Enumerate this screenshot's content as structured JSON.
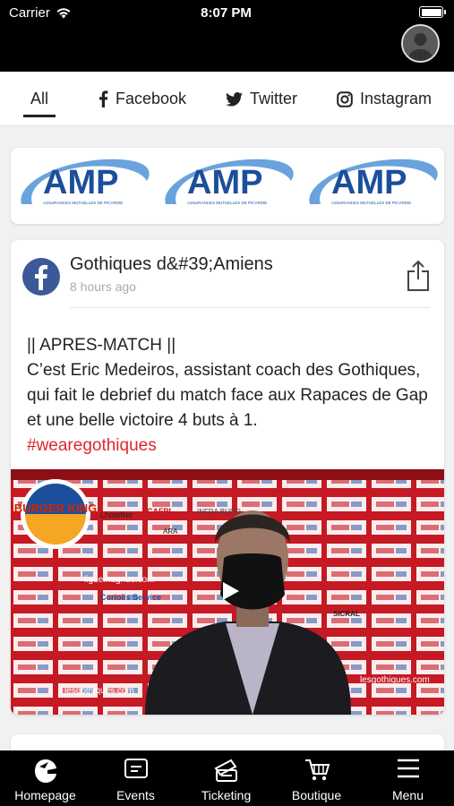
{
  "status_bar": {
    "carrier": "Carrier",
    "time": "8:07 PM"
  },
  "tabs": [
    {
      "label": "All",
      "icon": "none",
      "active": true
    },
    {
      "label": "Facebook",
      "icon": "facebook-icon",
      "active": false
    },
    {
      "label": "Twitter",
      "icon": "twitter-icon",
      "active": false
    },
    {
      "label": "Instagram",
      "icon": "instagram-icon",
      "active": false
    }
  ],
  "banner": {
    "brand": "AMP",
    "tagline": "ASSURANCES MUTUELLES DE PICARDIE"
  },
  "post": {
    "author": "Gothiques d&#39;Amiens",
    "time": "8 hours ago",
    "line1": "|| APRES-MATCH ||",
    "line2": "C’est Eric Medeiros, assistant coach des Gothiques, qui fait le debrief du match face aux Rapaces de Gap et une belle victoire 4 buts à 1.",
    "hashtag": "#wearegothiques",
    "media_sponsor": "BURGER KING",
    "media_boards": [
      "Lhotellier",
      "CAFPI",
      "INFRA BURO",
      "ARA",
      "liguemagnus.com",
      "Coriolis Service",
      "SICRAL",
      "lesgothiques.com"
    ]
  },
  "bottom_nav": [
    {
      "label": "Homepage",
      "icon": "home-logo-icon"
    },
    {
      "label": "Events",
      "icon": "events-icon"
    },
    {
      "label": "Ticketing",
      "icon": "ticket-icon"
    },
    {
      "label": "Boutique",
      "icon": "cart-icon"
    },
    {
      "label": "Menu",
      "icon": "menu-icon"
    }
  ],
  "colors": {
    "accent_red": "#e0262d",
    "facebook_blue": "#3b5998",
    "amp_blue": "#1b4f9c"
  }
}
